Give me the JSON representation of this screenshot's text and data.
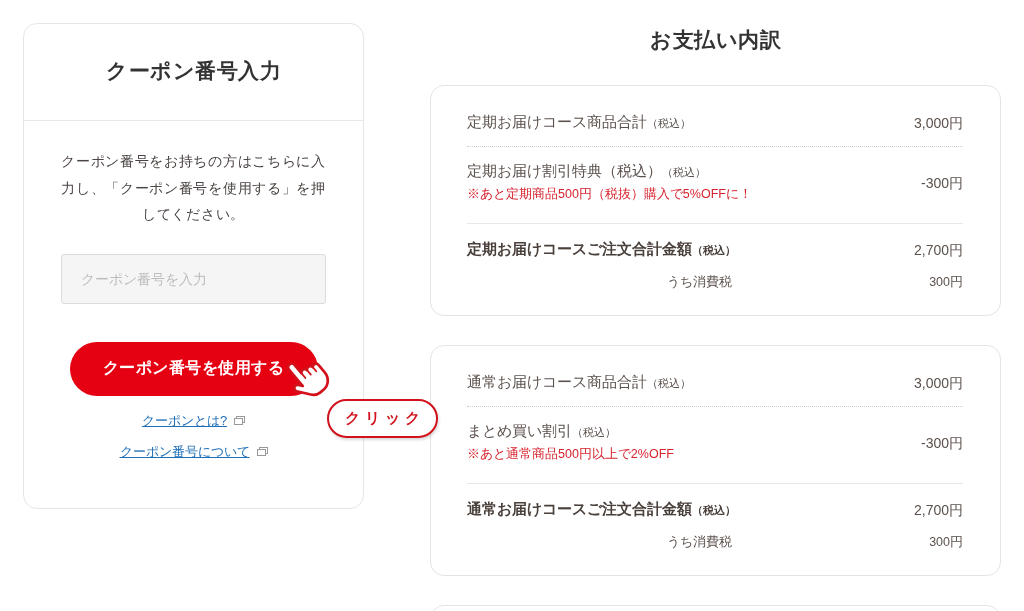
{
  "coupon": {
    "title": "クーポン番号入力",
    "description": "クーポン番号をお持ちの方はこちらに入力し、「クーポン番号を使用する」を押してください。",
    "input": {
      "placeholder": "クーポン番号を入力"
    },
    "button": {
      "label": "クーポン番号を使用する"
    },
    "callout": "クリック",
    "links": [
      {
        "label": "クーポンとは?"
      },
      {
        "label": "クーポン番号について"
      }
    ]
  },
  "payment": {
    "title": "お支払い内訳",
    "sections": [
      {
        "rows": [
          {
            "kind": "item",
            "label": "定期お届けコース商品合計",
            "suffix": "（税込）",
            "amount": "3,000円"
          },
          {
            "kind": "discount",
            "label": "定期お届け割引特典（税込）",
            "suffix": "（税込）",
            "note": "※あと定期商品500円（税抜）購入で5%OFFに！",
            "amount": "-300円"
          },
          {
            "kind": "total",
            "label": "定期お届けコースご注文合計金額",
            "suffix": "（税込）",
            "amount": "2,700円",
            "tax_label": "うち消費税",
            "tax_amount": "300円"
          }
        ]
      },
      {
        "rows": [
          {
            "kind": "item",
            "label": "通常お届けコース商品合計",
            "suffix": "（税込）",
            "amount": "3,000円"
          },
          {
            "kind": "discount",
            "label": "まとめ買い割引",
            "suffix": "（税込）",
            "note": "※あと通常商品500円以上で2%OFF",
            "amount": "-300円"
          },
          {
            "kind": "total",
            "label": "通常お届けコースご注文合計金額",
            "suffix": "（税込）",
            "amount": "2,700円",
            "tax_label": "うち消費税",
            "tax_amount": "300円"
          }
        ]
      }
    ]
  }
}
